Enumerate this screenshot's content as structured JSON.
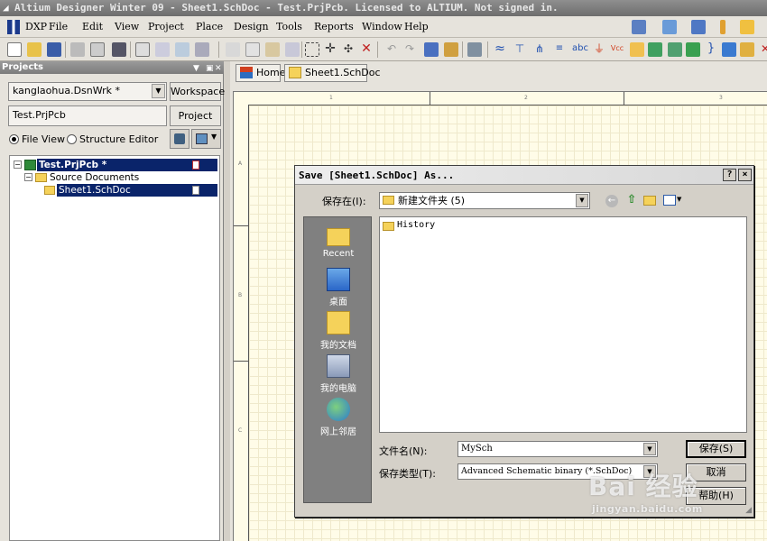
{
  "window": {
    "title": "Altium Designer Winter 09 - Sheet1.SchDoc - Test.PrjPcb. Licensed to ALTIUM. Not signed in."
  },
  "menu": [
    "DXP",
    "File",
    "Edit",
    "View",
    "Project",
    "Place",
    "Design",
    "Tools",
    "Reports",
    "Window",
    "Help"
  ],
  "projects_panel": {
    "title": "Projects",
    "workspace_combo": "kanglaohua.DsnWrk *",
    "workspace_button": "Workspace",
    "project_field": "Test.PrjPcb",
    "project_button": "Project",
    "view_options": [
      {
        "label": "File View",
        "selected": true
      },
      {
        "label": "Structure Editor",
        "selected": false
      }
    ],
    "tree": [
      {
        "label": "Test.PrjPcb *",
        "level": 0,
        "selected": true
      },
      {
        "label": "Source Documents",
        "level": 1,
        "selected": false
      },
      {
        "label": "Sheet1.SchDoc",
        "level": 2,
        "selected": true
      }
    ]
  },
  "doc_tabs": [
    "Home",
    "Sheet1.SchDoc"
  ],
  "sheet": {
    "columns": [
      "1",
      "2",
      "3"
    ],
    "rows": [
      "A",
      "B",
      "C"
    ]
  },
  "dialog": {
    "title": "Save [Sheet1.SchDoc] As...",
    "help_button": "?",
    "close_button": "×",
    "save_in_label": "保存在(I):",
    "save_in_value": "新建文件夹 (5)",
    "places": [
      "Recent",
      "桌面",
      "我的文档",
      "我的电脑",
      "网上邻居"
    ],
    "files": [
      "History"
    ],
    "filename_label": "文件名(N):",
    "filename_value": "MySch",
    "filetype_label": "保存类型(T):",
    "filetype_value": "Advanced Schematic binary (*.SchDoc)",
    "save_button": "保存(S)",
    "cancel_button": "取消",
    "help_btn": "帮助(H)"
  },
  "watermark": {
    "logo_text": "Bai 经验",
    "url": "jingyan.baidu.com"
  },
  "colors": {
    "selection": "#0a246a",
    "sheet_background": "#fffce8",
    "folder": "#f5d25a"
  }
}
